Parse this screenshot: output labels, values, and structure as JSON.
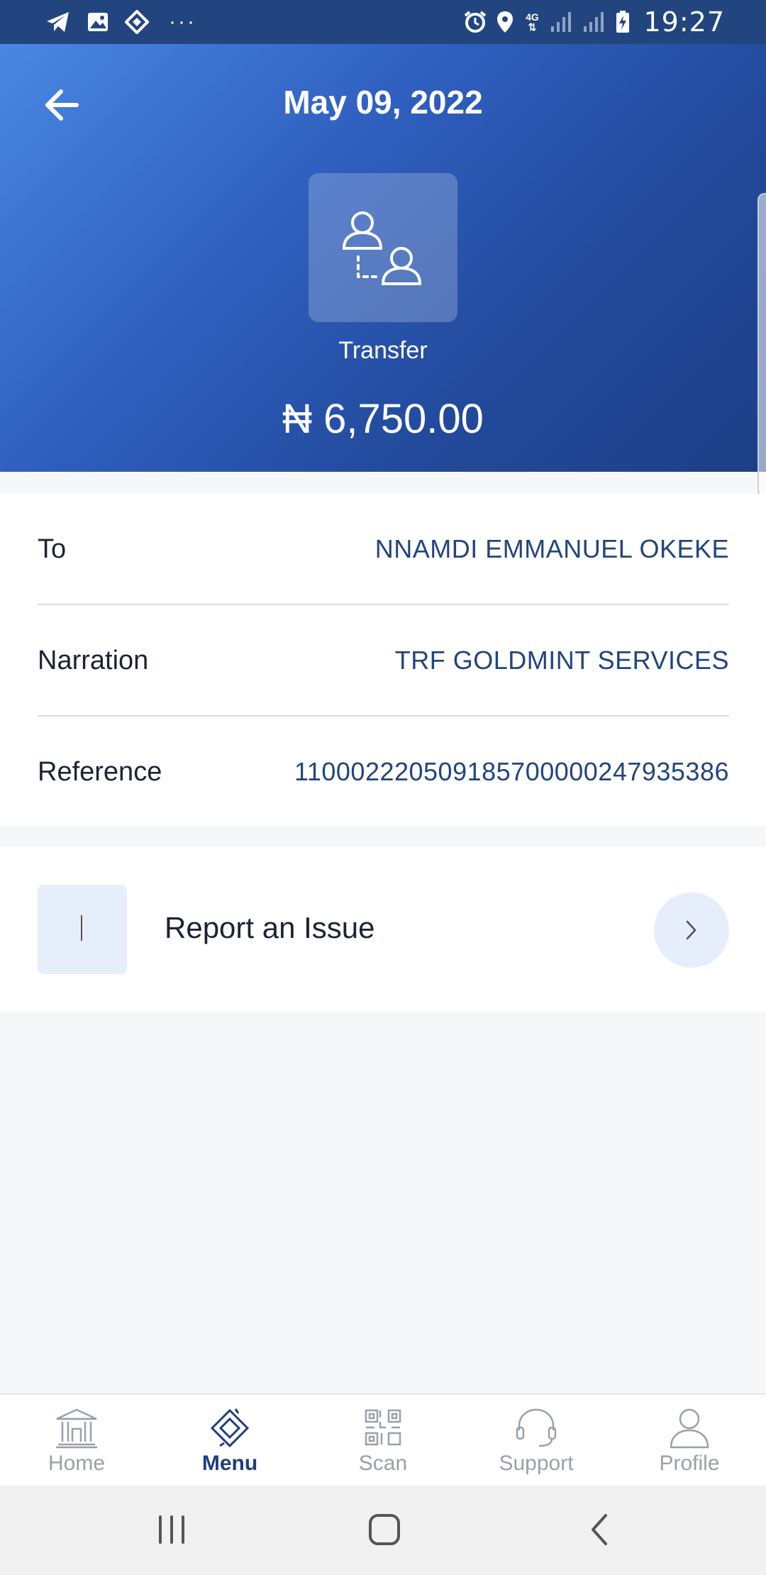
{
  "status_bar": {
    "time": "19:27",
    "network": "4G",
    "more_notifications": "···",
    "left_icons": [
      "telegram-icon",
      "gallery-icon",
      "binance-icon"
    ],
    "right_icons": [
      "alarm-icon",
      "location-icon",
      "signal-icon",
      "battery-charging-icon"
    ]
  },
  "header": {
    "title": "May 09, 2022",
    "transaction_type": "Transfer",
    "amount": "₦ 6,750.00",
    "icon": "transfer-people-icon"
  },
  "details": {
    "rows": [
      {
        "label": "To",
        "value": "NNAMDI EMMANUEL OKEKE"
      },
      {
        "label": "Narration",
        "value": "TRF GOLDMINT SERVICES"
      },
      {
        "label": "Reference",
        "value": "110002220509185700000247935386"
      }
    ]
  },
  "report": {
    "label": "Report an Issue"
  },
  "bottom_nav": {
    "active": "Menu",
    "items": [
      {
        "label": "Home",
        "icon": "bank-icon"
      },
      {
        "label": "Menu",
        "icon": "diamond-menu-icon"
      },
      {
        "label": "Scan",
        "icon": "qr-scan-icon"
      },
      {
        "label": "Support",
        "icon": "headset-icon"
      },
      {
        "label": "Profile",
        "icon": "user-icon"
      }
    ]
  },
  "colors": {
    "header_gradient_start": "#4a87e3",
    "header_gradient_end": "#1d3f86",
    "value_text": "#22457c",
    "active_nav": "#1f3f7c",
    "inactive_nav": "#9aa0ab",
    "report_icon_bg": "#e7eefb"
  }
}
